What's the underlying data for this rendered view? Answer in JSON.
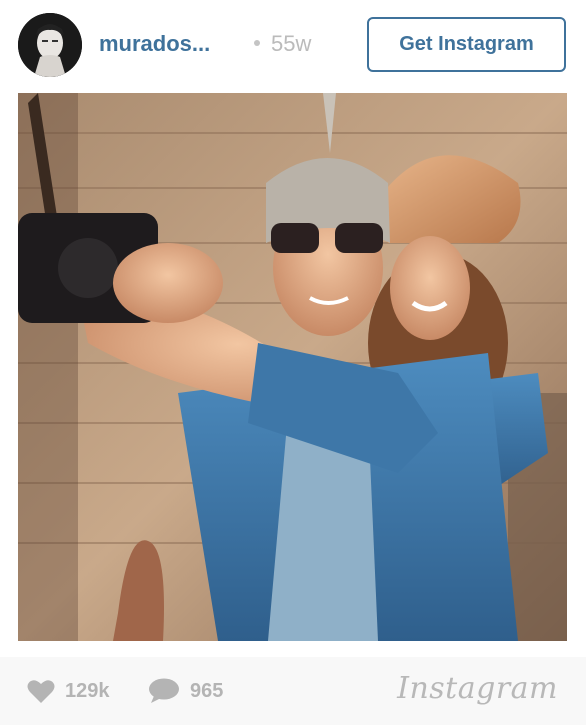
{
  "header": {
    "username": "murados...",
    "time_ago": "55w",
    "cta_label": "Get Instagram"
  },
  "post": {
    "photo_icon": "post-photo"
  },
  "footer": {
    "likes": "129k",
    "comments": "965",
    "brand": "Instagram"
  },
  "colors": {
    "link_blue": "#3f729b",
    "muted_grey": "#b4b4b4",
    "footer_bg": "#f8f8f8"
  },
  "icons": {
    "like": "heart-icon",
    "comment": "comment-bubble-icon"
  }
}
